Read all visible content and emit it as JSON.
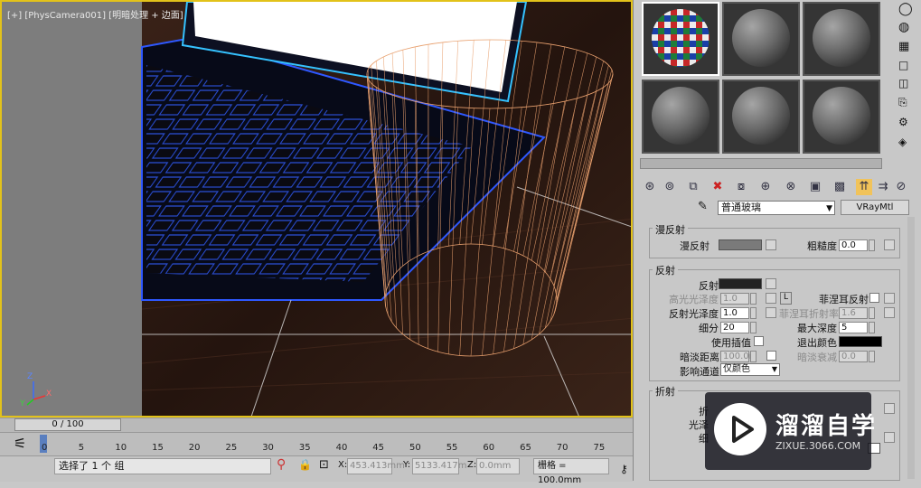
{
  "viewport": {
    "label": "[+] [PhysCamera001] [明暗处理 + 边面]",
    "axis": {
      "x": "X",
      "y": "Y",
      "z": "Z"
    }
  },
  "timeline": {
    "frame_display": "0 / 100",
    "ticks": [
      "0",
      "5",
      "10",
      "15",
      "20",
      "25",
      "30",
      "35",
      "40",
      "45",
      "50",
      "55",
      "60",
      "65",
      "70",
      "75"
    ]
  },
  "status": {
    "message": "选择了 1 个 组",
    "x_label": "X:",
    "x_value": "453.413mm",
    "y_label": "Y:",
    "y_value": "5133.417m",
    "z_label": "Z:",
    "z_value": "0.0mm",
    "grid": "栅格 = 100.0mm"
  },
  "material_editor": {
    "material_name": "普通玻璃",
    "material_type": "VRayMtl",
    "diffuse": {
      "title": "漫反射",
      "diffuse_label": "漫反射",
      "roughness_label": "粗糙度",
      "roughness_value": "0.0"
    },
    "reflection": {
      "title": "反射",
      "reflect_label": "反射",
      "hilight_gloss_label": "高光光泽度",
      "hilight_gloss_value": "1.0",
      "lock_label": "L",
      "fresnel_label": "菲涅耳反射",
      "refl_gloss_label": "反射光泽度",
      "refl_gloss_value": "1.0",
      "fresnel_ior_label": "菲涅耳折射率",
      "fresnel_ior_value": "1.6",
      "subdivs_label": "细分",
      "subdivs_value": "20",
      "max_depth_label": "最大深度",
      "max_depth_value": "5",
      "use_interp_label": "使用插值",
      "exit_color_label": "退出颜色",
      "dim_distance_label": "暗淡距离",
      "dim_distance_value": "100.0n",
      "dim_falloff_label": "暗淡衰减",
      "dim_falloff_value": "0.0",
      "affect_channels_label": "影响通道",
      "affect_channels_value": "仅颜色"
    },
    "refraction": {
      "title": "折射",
      "refract_label": "折",
      "gloss_label": "光泽",
      "subdivs_label": "细"
    }
  },
  "watermark": {
    "title": "溜溜自学",
    "subtitle": "ZIXUE.3066.COM"
  },
  "colors": {
    "viewport_border": "#e2c21a",
    "reflect_swatch": "#222222",
    "diffuse_swatch": "#7a7a7a",
    "exit_color": "#000000"
  }
}
